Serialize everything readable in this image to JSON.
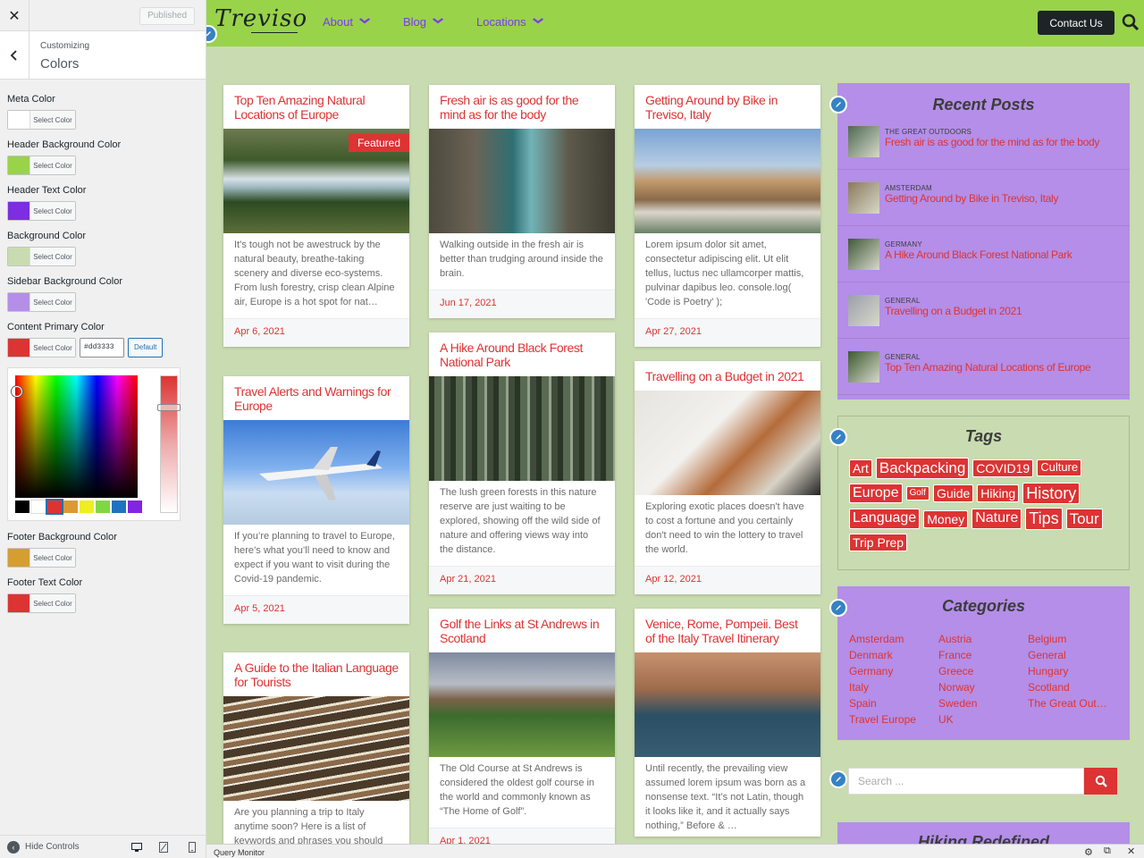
{
  "customizer": {
    "close_label": "✕",
    "published_label": "Published",
    "breadcrumb": "Customizing",
    "section_title": "Colors",
    "controls": [
      {
        "label": "Meta Color",
        "swatch": "#ffffff",
        "button": "Select Color"
      },
      {
        "label": "Header Background Color",
        "swatch": "#99d349",
        "button": "Select Color"
      },
      {
        "label": "Header Text Color",
        "swatch": "#7c2ee0",
        "button": "Select Color"
      },
      {
        "label": "Background Color",
        "swatch": "#c9dbb0",
        "button": "Select Color"
      },
      {
        "label": "Sidebar Background Color",
        "swatch": "#b48ee8",
        "button": "Select Color"
      },
      {
        "label": "Content Primary Color",
        "swatch": "#dd3333",
        "button": "Select Color",
        "hex_value": "#dd3333",
        "default_label": "Default"
      },
      {
        "label": "Footer Background Color",
        "swatch": "#d59e33",
        "button": "Select Color"
      },
      {
        "label": "Footer Text Color",
        "swatch": "#dd3333",
        "button": "Select Color"
      }
    ],
    "palette": [
      "#000000",
      "#ffffff",
      "#dd3333",
      "#dd9933",
      "#eeee22",
      "#81d742",
      "#1e73be",
      "#8224e3"
    ],
    "hide_controls_label": "Hide Controls"
  },
  "site": {
    "logo": "Treviso",
    "nav": [
      "About",
      "Blog",
      "Locations"
    ],
    "contact_label": "Contact Us",
    "header_bg": "#99d349",
    "accent": "#dd3333",
    "sidebar_bg": "#b48ee8",
    "page_bg": "#c9dbb0"
  },
  "posts": [
    {
      "title": "Top Ten Amazing Natural Locations of Europe",
      "badge": "Featured",
      "excerpt": "It’s tough not be awestruck by the natural beauty, breathe-taking scenery and diverse eco-systems. From lush forestry, crisp clean Alpine air, Europe is a hot spot for nat…",
      "date": "Apr 6, 2021"
    },
    {
      "title": "Travel Alerts and Warnings for Europe",
      "excerpt": "If you’re planning to travel to Europe, here’s what you’ll need to know and expect if you want to visit during the Covid-19 pandemic.",
      "date": "Apr 5, 2021"
    },
    {
      "title": "A Guide to the Italian Language for Tourists",
      "excerpt": "Are you planning a trip to Italy anytime soon? Here is a list of keywords and phrases you should",
      "date": ""
    },
    {
      "title": "Fresh air is as good for the mind as for the body",
      "excerpt": "Walking outside in the fresh air is better than trudging around inside the brain.",
      "date": "Jun 17, 2021"
    },
    {
      "title": "A Hike Around Black Forest National Park",
      "excerpt": "The lush green forests in this nature reserve are just waiting to be explored, showing off the wild side of nature and offering views way into the distance.",
      "date": "Apr 21, 2021"
    },
    {
      "title": "Golf the Links at St Andrews in Scotland",
      "excerpt": "The Old Course at St Andrews is considered the oldest golf course in the world and commonly known as “The Home of Golf”.",
      "date": "Apr 1, 2021"
    },
    {
      "title": "Getting Around by Bike in Treviso, Italy",
      "excerpt": "Lorem ipsum dolor sit amet, consectetur adipiscing elit. Ut elit tellus, luctus nec ullamcorper mattis, pulvinar dapibus leo. console.log( 'Code is Poetry' );",
      "date": "Apr 27, 2021"
    },
    {
      "title": "Travelling on a Budget in 2021",
      "excerpt": "Exploring exotic places doesn't have to cost a fortune and you certainly don't need to win the lottery to travel the world.",
      "date": "Apr 12, 2021"
    },
    {
      "title": "Venice, Rome, Pompeii. Best of the Italy Travel Itinerary",
      "excerpt": "Until recently, the prevailing view assumed lorem ipsum was born as a nonsense text. “It’s not Latin, though it looks like it, and it actually says nothing,” Before & …",
      "date": ""
    }
  ],
  "recent_posts": {
    "title": "Recent Posts",
    "items": [
      {
        "category": "THE GREAT OUTDOORS",
        "title": "Fresh air is as good for the mind as for the body"
      },
      {
        "category": "AMSTERDAM",
        "title": "Getting Around by Bike in Treviso, Italy"
      },
      {
        "category": "GERMANY",
        "title": "A Hike Around Black Forest National Park"
      },
      {
        "category": "GENERAL",
        "title": "Travelling on a Budget in 2021"
      },
      {
        "category": "GENERAL",
        "title": "Top Ten Amazing Natural Locations of Europe"
      }
    ]
  },
  "tags": {
    "title": "Tags",
    "items": [
      "Art",
      "Backpacking",
      "COVID19",
      "Culture",
      "Europe",
      "Golf",
      "Guide",
      "Hiking",
      "History",
      "Language",
      "Money",
      "Nature",
      "Tips",
      "Tour",
      "Trip Prep"
    ]
  },
  "categories": {
    "title": "Categories",
    "items": [
      "Amsterdam",
      "Austria",
      "Belgium",
      "Denmark",
      "France",
      "General",
      "Germany",
      "Greece",
      "Hungary",
      "Italy",
      "Norway",
      "Scotland",
      "Spain",
      "Sweden",
      "The Great Out…",
      "Travel Europe",
      "UK"
    ]
  },
  "search": {
    "placeholder": "Search ..."
  },
  "next_widget_title": "Hiking Redefined",
  "query_monitor": "Query Monitor"
}
